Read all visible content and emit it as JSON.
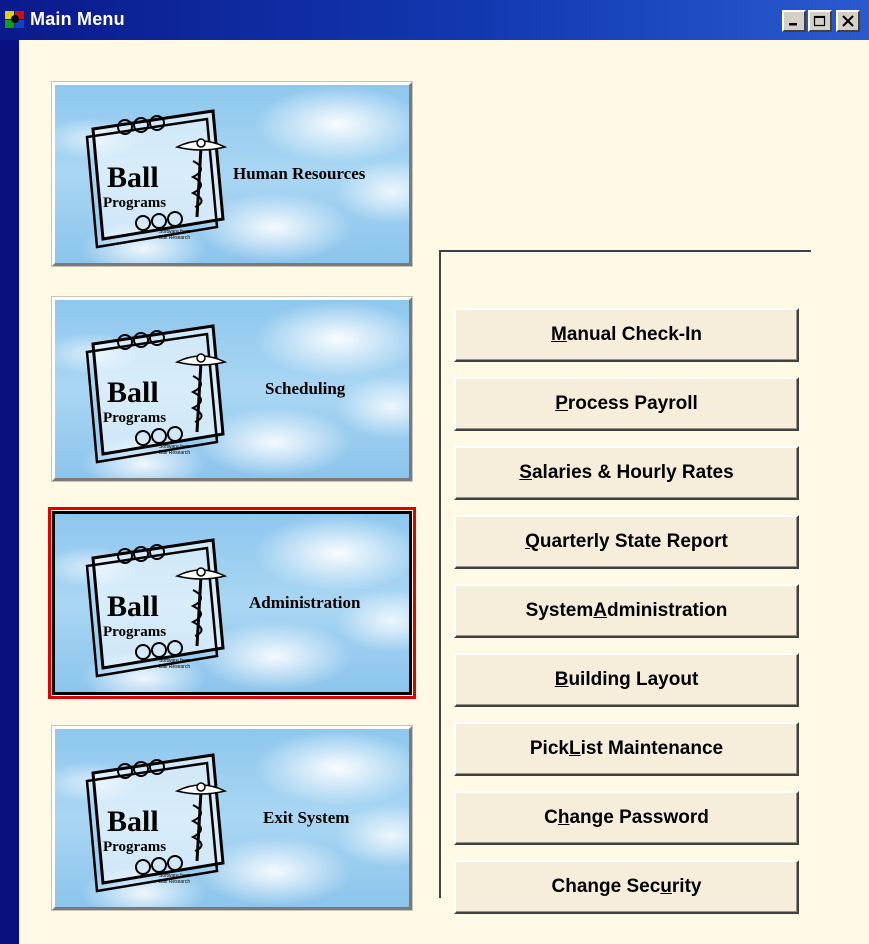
{
  "window": {
    "title": "Main Menu",
    "controls": [
      "minimize",
      "maximize",
      "close"
    ]
  },
  "logo": {
    "line1": "Ball",
    "line2": "Programs",
    "tagline1": "Software from",
    "tagline2": "Ball Research"
  },
  "image_buttons": [
    {
      "label": "Human Resources",
      "selected": false
    },
    {
      "label": "Scheduling",
      "selected": false
    },
    {
      "label": "Administration",
      "selected": true
    },
    {
      "label": "Exit System",
      "selected": false
    }
  ],
  "menu_buttons": [
    {
      "pre": "",
      "key": "M",
      "post": "anual Check-In"
    },
    {
      "pre": "",
      "key": "P",
      "post": "rocess Payroll"
    },
    {
      "pre": "",
      "key": "S",
      "post": "alaries & Hourly Rates"
    },
    {
      "pre": "",
      "key": "Q",
      "post": "uarterly State Report"
    },
    {
      "pre": "System ",
      "key": "A",
      "post": "dministration"
    },
    {
      "pre": "",
      "key": "B",
      "post": "uilding Layout"
    },
    {
      "pre": "Pick ",
      "key": "L",
      "post": "ist Maintenance"
    },
    {
      "pre": "C",
      "key": "h",
      "post": "ange Password"
    },
    {
      "pre": "Change Sec",
      "key": "u",
      "post": "rity"
    }
  ],
  "colors": {
    "desktop": "#0a1080",
    "client": "#fff9e6",
    "selection": "#e00000"
  }
}
